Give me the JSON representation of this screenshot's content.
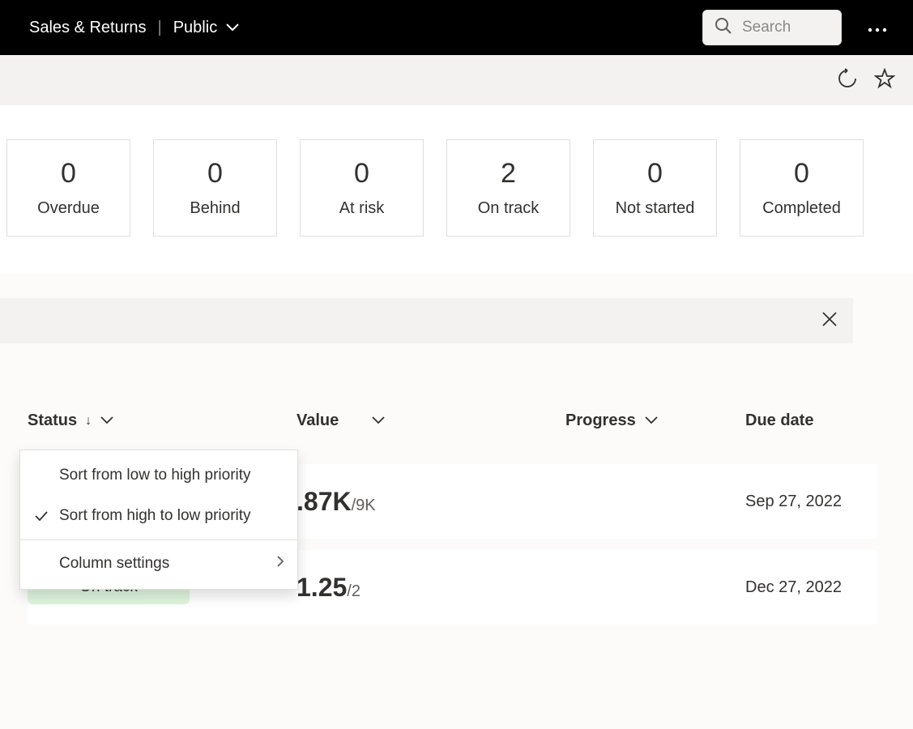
{
  "topbar": {
    "title": "Sales & Returns",
    "scope": "Public",
    "search_placeholder": "Search"
  },
  "cards": [
    {
      "value": "0",
      "label": "Overdue"
    },
    {
      "value": "0",
      "label": "Behind"
    },
    {
      "value": "0",
      "label": "At risk"
    },
    {
      "value": "2",
      "label": "On track"
    },
    {
      "value": "0",
      "label": "Not started"
    },
    {
      "value": "0",
      "label": "Completed"
    }
  ],
  "columns": {
    "status": "Status",
    "value": "Value",
    "progress": "Progress",
    "due": "Due date"
  },
  "rows": [
    {
      "status": "",
      "value_main": ".87K",
      "value_denom": "/9K",
      "due": "Sep 27, 2022"
    },
    {
      "status": "On track",
      "value_main": "1.25",
      "value_denom": "/2",
      "due": "Dec 27, 2022"
    }
  ],
  "dropdown": {
    "low_high": "Sort from low to high priority",
    "high_low": "Sort from high to low priority",
    "column_settings": "Column settings"
  }
}
